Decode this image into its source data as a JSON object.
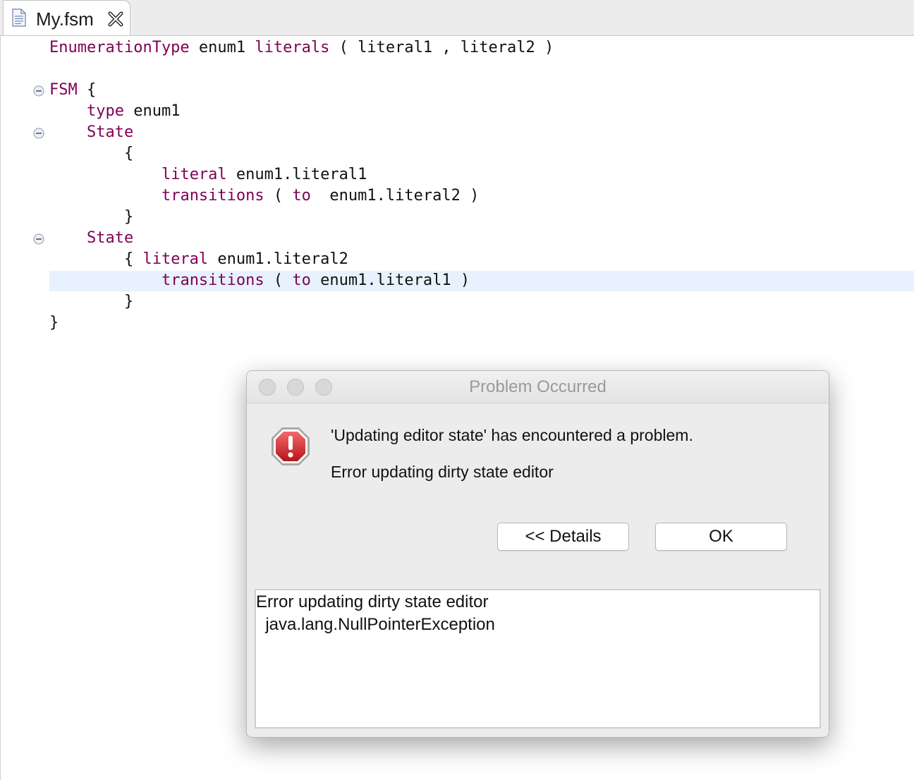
{
  "tab": {
    "label": "My.fsm",
    "icon": "file-text-icon",
    "close_icon": "close-icon"
  },
  "code": {
    "l1": {
      "k1": "EnumerationType",
      "t1": " enum1 ",
      "k2": "literals",
      "t2": " ( literal1 , literal2 )"
    },
    "l3": {
      "k1": "FSM",
      "t1": " {"
    },
    "l4": {
      "indent": "    ",
      "k1": "type",
      "t1": " enum1"
    },
    "l5": {
      "indent": "    ",
      "k1": "State"
    },
    "l6": {
      "text": "        {"
    },
    "l7": {
      "indent": "            ",
      "k1": "literal",
      "t1": " enum1.literal1"
    },
    "l8": {
      "indent": "            ",
      "k1": "transitions",
      "t1": " ( ",
      "k2": "to",
      "t2": "  enum1.literal2 )"
    },
    "l9": {
      "text": "        }"
    },
    "l10": {
      "indent": "    ",
      "k1": "State"
    },
    "l11": {
      "indent": "        { ",
      "k1": "literal",
      "t1": " enum1.literal2"
    },
    "l12": {
      "indent": "            ",
      "k1": "transitions",
      "t1": " ( ",
      "k2": "to",
      "t2": " enum1.literal1 )"
    },
    "l13": {
      "text": "        }"
    },
    "l14": {
      "text": "}"
    }
  },
  "colors": {
    "keyword": "#7f0055",
    "current_line": "#e8f2fe"
  },
  "dialog": {
    "title": "Problem Occurred",
    "icon": "error-stop-icon",
    "message": "'Updating editor state' has encountered a problem.",
    "detail_message": "Error updating dirty state editor",
    "details_button": "<< Details",
    "ok_button": "OK",
    "details_lines": [
      "Error updating dirty state editor",
      "  java.lang.NullPointerException"
    ]
  }
}
